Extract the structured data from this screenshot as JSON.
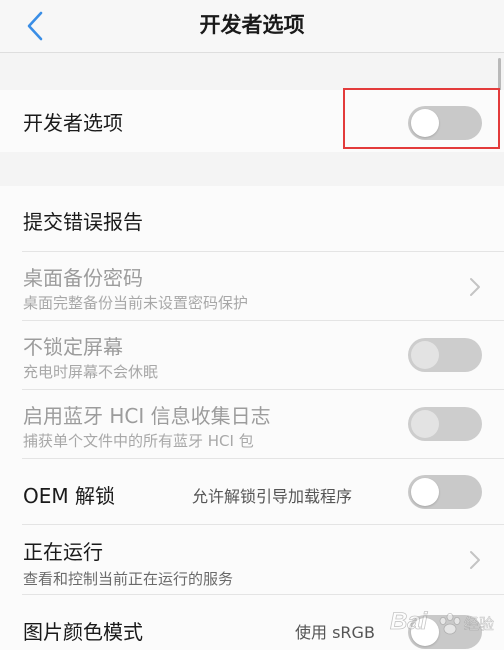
{
  "nav": {
    "title": "开发者选项",
    "back_icon": "chevron-left-icon"
  },
  "colors": {
    "accent": "#3a8ee6",
    "highlight_box": "#e33b3b",
    "toggle_off": "#c9c9c9"
  },
  "developer_toggle": {
    "label": "开发者选项",
    "enabled": false
  },
  "items": [
    {
      "title": "提交错误报告"
    },
    {
      "title": "桌面备份密码",
      "subtitle": "桌面完整备份当前未设置密码保护",
      "disabled": true,
      "icon": "chevron-right-icon"
    },
    {
      "title": "不锁定屏幕",
      "subtitle": "充电时屏幕不会休眠",
      "disabled": true,
      "toggle_on": false
    },
    {
      "title": "启用蓝牙 HCI 信息收集日志",
      "subtitle": "捕获单个文件中的所有蓝牙 HCI 包",
      "disabled": true,
      "toggle_on": false
    },
    {
      "title": "OEM 解锁",
      "value": "允许解锁引导加载程序",
      "toggle_on": false
    },
    {
      "title": "正在运行",
      "subtitle": "查看和控制当前正在运行的服务",
      "icon": "chevron-right-icon"
    },
    {
      "title": "图片颜色模式",
      "value": "使用 sRGB",
      "toggle_on": false
    }
  ],
  "watermark": {
    "brand": "Bai",
    "suffix": "经验",
    "icon": "paw-icon"
  }
}
